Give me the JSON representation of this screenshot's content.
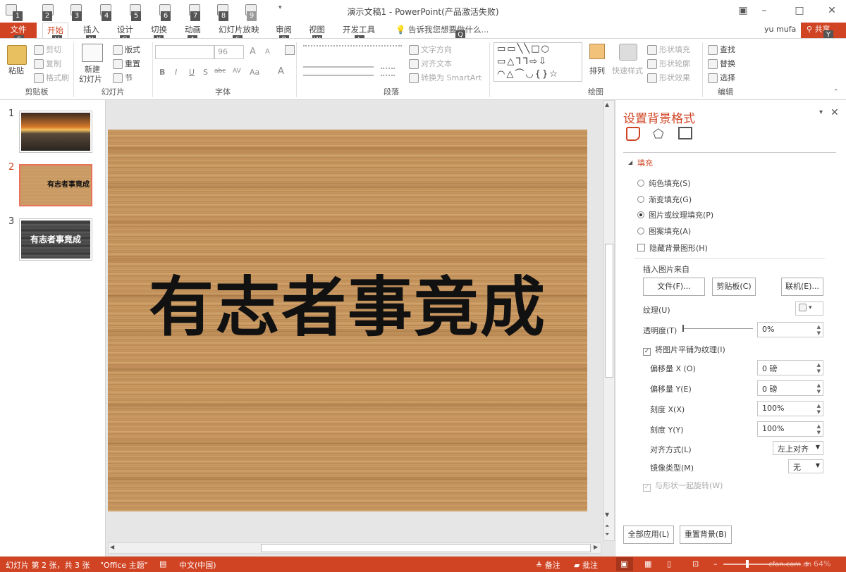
{
  "window": {
    "title": "演示文稿1 - PowerPoint(产品激活失败)",
    "user": "yu mufa",
    "share": "共享"
  },
  "qat_keytips": [
    "1",
    "2",
    "3",
    "4",
    "5",
    "6",
    "7",
    "8",
    "9"
  ],
  "tabs": [
    {
      "label": "文件",
      "keytip": "F"
    },
    {
      "label": "开始",
      "keytip": "H"
    },
    {
      "label": "插入",
      "keytip": "N"
    },
    {
      "label": "设计",
      "keytip": "G"
    },
    {
      "label": "切换",
      "keytip": "K"
    },
    {
      "label": "动画",
      "keytip": "A"
    },
    {
      "label": "幻灯片放映",
      "keytip": "S"
    },
    {
      "label": "审阅",
      "keytip": "R"
    },
    {
      "label": "视图",
      "keytip": "W"
    },
    {
      "label": "开发工具",
      "keytip": "L"
    }
  ],
  "tellme": {
    "text": "告诉我您想要做什么...",
    "keytip": "Q"
  },
  "share_keytip": "Y",
  "ribbon": {
    "clipboard": {
      "label": "剪贴板",
      "paste": "粘贴",
      "cut": "剪切",
      "copy": "复制",
      "format_painter": "格式刷"
    },
    "slides": {
      "label": "幻灯片",
      "new_slide": "新建",
      "new_slide2": "幻灯片",
      "layout": "版式",
      "reset": "重置",
      "section": "节"
    },
    "font": {
      "label": "字体",
      "size": "96",
      "bold": "B",
      "italic": "I",
      "underline": "U",
      "shadow": "S",
      "strike": "abc",
      "spacing": "AV",
      "case": "Aa",
      "color": "A",
      "grow": "A",
      "shrink": "A"
    },
    "paragraph": {
      "label": "段落",
      "text_direction": "文字方向",
      "align_text": "对齐文本",
      "smartart": "转换为 SmartArt"
    },
    "drawing": {
      "label": "绘图",
      "arrange": "排列",
      "quick_styles": "快速样式",
      "shape_fill": "形状填充",
      "shape_outline": "形状轮廓",
      "shape_effects": "形状效果"
    },
    "editing": {
      "label": "编辑",
      "find": "查找",
      "replace": "替换",
      "select": "选择"
    }
  },
  "thumbnails": [
    {
      "num": "1",
      "text": ""
    },
    {
      "num": "2",
      "text": "有志者事竟成"
    },
    {
      "num": "3",
      "text": "有志者事竟成"
    }
  ],
  "slide": {
    "text": "有志者事竟成"
  },
  "pane": {
    "title": "设置背景格式",
    "section": "填充",
    "options": [
      {
        "label": "纯色填充(S)",
        "selected": false
      },
      {
        "label": "渐变填充(G)",
        "selected": false
      },
      {
        "label": "图片或纹理填充(P)",
        "selected": true
      },
      {
        "label": "图案填充(A)",
        "selected": false
      }
    ],
    "hide_bg": "隐藏背景图形(H)",
    "insert_from": "插入图片来自",
    "file_btn": "文件(F)...",
    "clipboard_btn": "剪贴板(C)",
    "online_btn": "联机(E)...",
    "texture": "纹理(U)",
    "transparency": "透明度(T)",
    "transparency_val": "0%",
    "tile": "将图片平铺为纹理(I)",
    "offset_x": "偏移量 X (O)",
    "offset_x_val": "0 磅",
    "offset_y": "偏移量 Y(E)",
    "offset_y_val": "0 磅",
    "scale_x": "刻度 X(X)",
    "scale_x_val": "100%",
    "scale_y": "刻度 Y(Y)",
    "scale_y_val": "100%",
    "alignment": "对齐方式(L)",
    "alignment_val": "左上对齐",
    "mirror": "镜像类型(M)",
    "mirror_val": "无",
    "rotate": "与形状一起旋转(W)",
    "apply_all": "全部应用(L)",
    "reset_bg": "重置背景(B)"
  },
  "status": {
    "slide": "幻灯片 第 2 张，共 3 张",
    "theme": "\"Office 主题\"",
    "lang": "中文(中国)",
    "notes": "备注",
    "comments": "批注",
    "zoom": "64%",
    "watermark": "cfan.com.cn"
  },
  "colors": {
    "accent": "#d04424"
  }
}
